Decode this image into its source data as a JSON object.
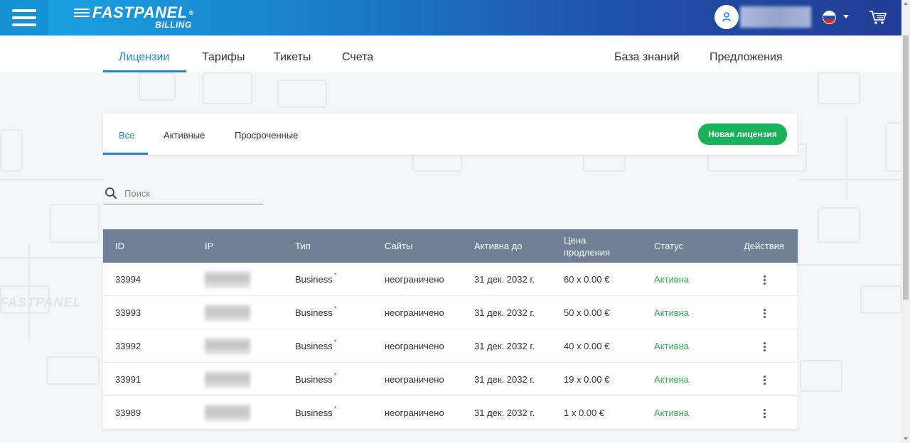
{
  "header": {
    "brand": "FASTPANEL",
    "brand_mark": "®",
    "sub": "BILLING",
    "user_icon": "user-icon",
    "language_flag": "russian-flag-icon",
    "cart_icon": "cart-icon",
    "menu_icon": "hamburger-menu-icon"
  },
  "nav": {
    "left": [
      "Лицензии",
      "Тарифы",
      "Тикеты",
      "Счета"
    ],
    "right": [
      "База знаний",
      "Предложения"
    ],
    "active": "Лицензии"
  },
  "filters": {
    "tabs": [
      "Все",
      "Активные",
      "Просроченные"
    ],
    "active": "Все",
    "new_button": "Новая лицензия"
  },
  "search": {
    "placeholder": "Поиск",
    "value": "",
    "icon": "search-icon"
  },
  "table": {
    "columns": [
      "ID",
      "IP",
      "Тип",
      "Сайты",
      "Активна до",
      "Цена продления",
      "Статус",
      "Действия"
    ],
    "rows": [
      {
        "id": "33994",
        "type": "Business",
        "type_mark": "*",
        "sites": "неограничено",
        "until": "31 дек. 2032 г.",
        "price": "60 x 0.00 €",
        "status": "Активна"
      },
      {
        "id": "33993",
        "type": "Business",
        "type_mark": "*",
        "sites": "неограничено",
        "until": "31 дек. 2032 г.",
        "price": "50 x 0.00 €",
        "status": "Активна"
      },
      {
        "id": "33992",
        "type": "Business",
        "type_mark": "*",
        "sites": "неограничено",
        "until": "31 дек. 2032 г.",
        "price": "40 x 0.00 €",
        "status": "Активна"
      },
      {
        "id": "33991",
        "type": "Business",
        "type_mark": "*",
        "sites": "неограничено",
        "until": "31 дек. 2032 г.",
        "price": "19 x 0.00 €",
        "status": "Активна"
      },
      {
        "id": "33989",
        "type": "Business",
        "type_mark": "*",
        "sites": "неограничено",
        "until": "31 дек. 2032 г.",
        "price": "1 x 0.00 €",
        "status": "Активна"
      }
    ]
  },
  "background_watermark": "FASTPANEL",
  "colors": {
    "accent": "#1e88d4",
    "header_start": "#19a6e3",
    "header_end": "#233d96",
    "button_green": "#16b35a",
    "status_active": "#2ead55",
    "table_header": "#6e7f96"
  }
}
